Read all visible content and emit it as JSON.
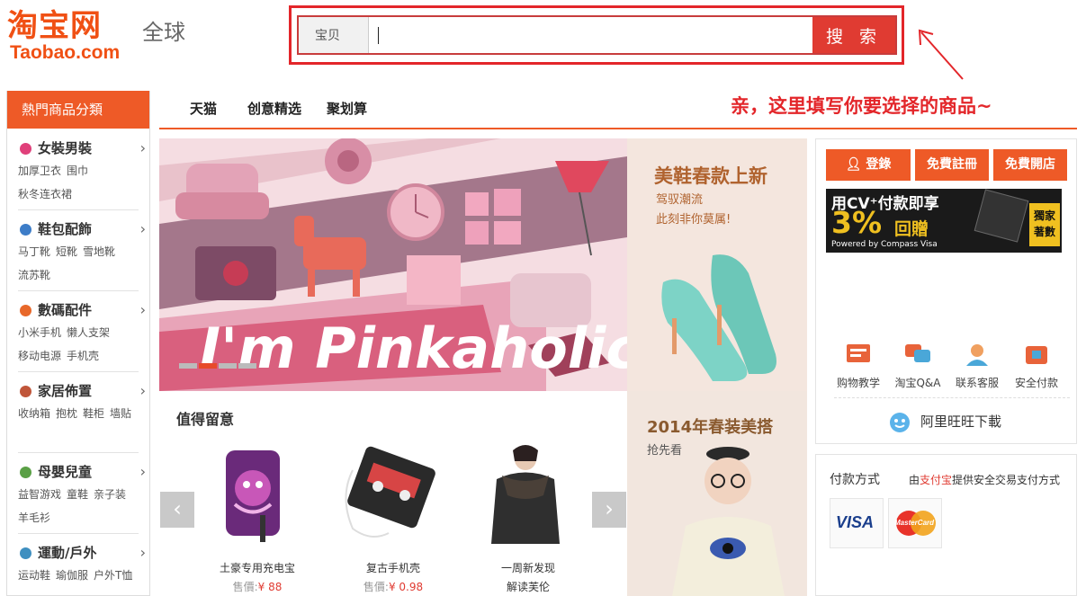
{
  "header": {
    "logo_cn": "淘宝网",
    "logo_en": "Taobao.com",
    "region": "全球",
    "search": {
      "tab": "宝贝",
      "value": "",
      "button": "搜 索"
    },
    "callout": "亲，这里填写你要选择的商品~"
  },
  "categories": {
    "title": "熱門商品分類",
    "sections": [
      {
        "icon": "clothes-icon",
        "title": "女裝男裝",
        "links": [
          "加厚卫衣",
          "围巾",
          "秋冬连衣裙"
        ]
      },
      {
        "icon": "bag-icon",
        "title": "鞋包配飾",
        "links": [
          "马丁靴",
          "短靴",
          "雪地靴",
          "流苏靴"
        ]
      },
      {
        "icon": "phone-icon",
        "title": "數碼配件",
        "links": [
          "小米手机",
          "懒人支架",
          "移动电源",
          "手机壳"
        ]
      },
      {
        "icon": "home-icon",
        "title": "家居佈置",
        "links": [
          "收纳箱",
          "抱枕",
          "鞋柜",
          "墙贴"
        ]
      },
      {
        "icon": "baby-icon",
        "title": "母嬰兒童",
        "links": [
          "益智游戏",
          "童鞋",
          "亲子装",
          "羊毛衫"
        ]
      },
      {
        "icon": "sport-icon",
        "title": "運動/戶外",
        "links": [
          "运动鞋",
          "瑜伽服",
          "户外T恤"
        ]
      }
    ]
  },
  "nav": {
    "items": [
      "天猫",
      "创意精选",
      "聚划算"
    ]
  },
  "banner": {
    "headline": "I'm Pinkaholic"
  },
  "shoe_ad": {
    "title": "美鞋春款上新",
    "line1": "驾驭潮流",
    "line2": "此刻非你莫属!"
  },
  "recommend": {
    "title": "值得留意",
    "products": [
      {
        "name": "土豪专用充电宝",
        "price_label": "售價:",
        "price": "¥ 88"
      },
      {
        "name": "复古手机壳",
        "price_label": "售價:",
        "price": "¥ 0.98"
      },
      {
        "name": "一周新发现",
        "subtitle": "解读芙伦"
      }
    ]
  },
  "spring_ad": {
    "title": "2014年春装美搭",
    "sub": "抢先看"
  },
  "user_panel": {
    "buttons": [
      "登錄",
      "免費註冊",
      "免費開店"
    ],
    "promo": {
      "line1": "用CV⁺付款即享",
      "big": "3%",
      "line2": "回贈",
      "powered": "Powered by Compass Visa",
      "badge1": "獨家",
      "badge2": "著數"
    },
    "services": [
      {
        "icon": "tutorial-icon",
        "label": "购物教学"
      },
      {
        "icon": "qa-icon",
        "label": "淘宝Q&A"
      },
      {
        "icon": "support-icon",
        "label": "联系客服"
      },
      {
        "icon": "secure-pay-icon",
        "label": "安全付款"
      }
    ],
    "wangwang": "阿里旺旺下載"
  },
  "payment": {
    "title": "付款方式",
    "desc_pre": "由",
    "desc_link": "支付宝",
    "desc_post": "提供安全交易支付方式",
    "cards": [
      "VISA",
      "MasterCard"
    ]
  },
  "colors": {
    "brand": "#ee5a27",
    "search_red": "#e03b32",
    "callout_red": "#e3262a"
  }
}
